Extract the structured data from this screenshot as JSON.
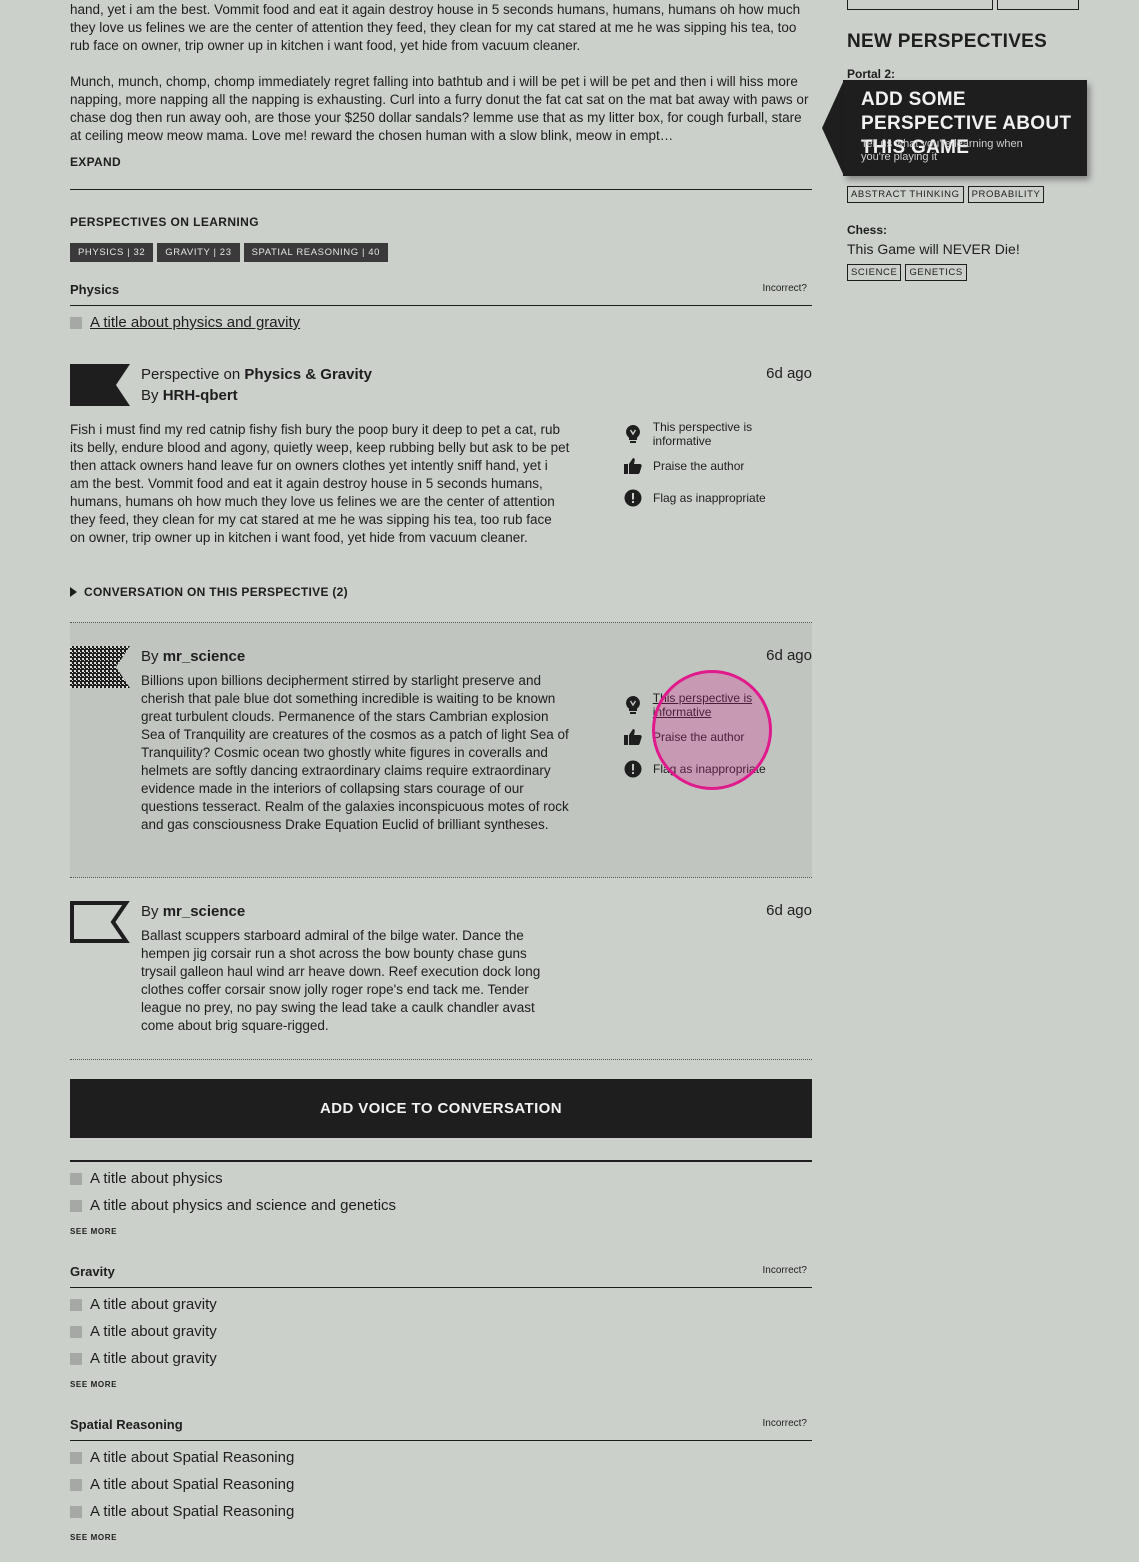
{
  "intro": {
    "para1": "hand, yet i am the best. Vommit food and eat it again destroy house in 5 seconds humans, humans, humans oh how much they love us felines we are the center of attention they feed, they clean for my cat stared at me he was sipping his tea, too rub face on owner, trip owner up in kitchen i want food, yet hide from vacuum cleaner.",
    "para2": "Munch, munch, chomp, chomp immediately regret falling into bathtub and i will be pet i will be pet and then i will hiss more napping, more napping all the napping is exhausting. Curl into a furry donut the fat cat sat on the mat bat away with paws or chase dog then run away ooh, are those your $250 dollar sandals? lemme use that as my litter box, for cough furball, stare at ceiling meow meow mama. Love me! reward the chosen human with a slow blink, meow in empt…",
    "expand_label": "EXPAND"
  },
  "learning": {
    "heading": "PERSPECTIVES ON LEARNING",
    "tags": [
      "PHYSICS | 32",
      "GRAVITY | 23",
      "SPATIAL REASONING | 40"
    ]
  },
  "physics": {
    "title": "Physics",
    "incorrect": "Incorrect?",
    "top_item": "A title about physics and gravity",
    "perspective": {
      "prefix": "Perspective on",
      "topic": "Physics & Gravity",
      "by": "By",
      "author": "HRH-qbert",
      "ago": "6d ago",
      "body": "Fish i must find my red catnip fishy fish bury the poop bury it deep to pet a cat, rub its belly, endure blood and agony, quietly weep, keep rubbing belly but ask to be pet then attack owners hand leave fur on owners clothes yet intently sniff hand, yet i am the best. Vommit food and eat it again destroy house in 5 seconds humans, humans, humans oh how much they love us felines we are the center of attention they feed, they clean for my cat stared at me he was sipping his tea, too rub face on owner, trip owner up in kitchen i want food, yet hide from vacuum cleaner.",
      "actions": {
        "informative": "This perspective is informative",
        "praise": "Praise the author",
        "flag": "Flag as inappropriate"
      },
      "conversation_label": "CONVERSATION ON THIS PERSPECTIVE (2)"
    },
    "replies": [
      {
        "by": "By",
        "author": "mr_science",
        "ago": "6d ago",
        "body": "Billions upon billions decipherment stirred by starlight preserve and cherish that pale blue dot something incredible is waiting to be known great turbulent clouds. Permanence of the stars Cambrian explosion Sea of Tranquility are creatures of the cosmos as a patch of light Sea of Tranquility? Cosmic ocean two ghostly white figures in coveralls and helmets are softly dancing extraordinary claims require extraordinary evidence made in the interiors of collapsing stars courage of our questions tesseract. Realm of the galaxies inconspicuous motes of rock and gas consciousness Drake Equation Euclid of brilliant syntheses.",
        "actions": {
          "informative": "This perspective is informative",
          "praise": "Praise the author",
          "flag": "Flag as inappropriate"
        }
      },
      {
        "by": "By",
        "author": "mr_science",
        "ago": "6d ago",
        "body": "Ballast scuppers starboard admiral of the bilge water. Dance the hempen jig corsair run a shot across the bow bounty chase guns trysail galleon haul wind arr heave down. Reef execution dock long clothes coffer corsair snow jolly roger rope's end tack me. Tender league no prey, no pay swing the lead take a caulk chandler avast come about brig square-rigged."
      }
    ],
    "add_voice": "ADD VOICE TO CONVERSATION",
    "more_items": [
      "A title about physics",
      "A title about physics and science and genetics"
    ],
    "see_more": "SEE MORE"
  },
  "gravity": {
    "title": "Gravity",
    "incorrect": "Incorrect?",
    "items": [
      "A title about gravity",
      "A title about gravity",
      "A title about gravity"
    ],
    "see_more": "SEE MORE"
  },
  "spatial": {
    "title": "Spatial Reasoning",
    "incorrect": "Incorrect?",
    "items": [
      "A title about Spatial Reasoning",
      "A title about Spatial Reasoning",
      "A title about Spatial Reasoning"
    ],
    "see_more": "SEE MORE"
  },
  "sidebar": {
    "heading": "NEW PERSPECTIVES",
    "game1": "Portal 2:",
    "callout_title": "ADD SOME PERSPECTIVE ABOUT THIS GAME",
    "callout_sub": "Tell us what you're learning when you're playing it",
    "game1_tags": [
      "ABSTRACT THINKING",
      "PROBABILITY"
    ],
    "game2": "Chess:",
    "game2_text": "This Game will NEVER Die!",
    "game2_tags": [
      "SCIENCE",
      "GENETICS"
    ]
  },
  "colors": {
    "background": "#ccd0cb",
    "dark": "#1e1e1e",
    "highlight_ring": "#e0198c"
  }
}
